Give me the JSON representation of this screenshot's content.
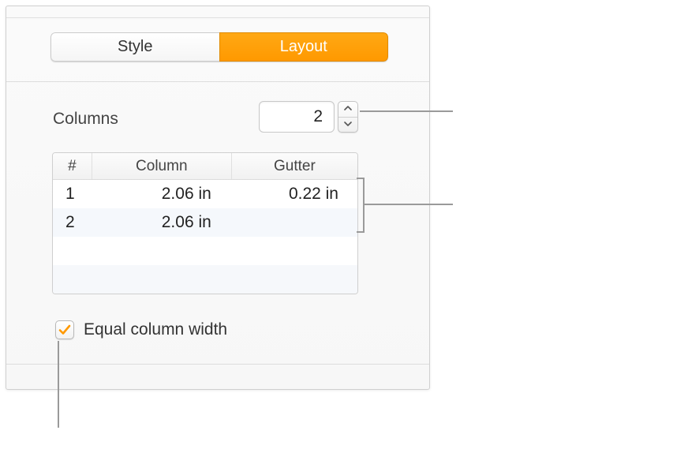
{
  "tabs": {
    "style": "Style",
    "layout": "Layout"
  },
  "columns": {
    "label": "Columns",
    "count": "2"
  },
  "table": {
    "headers": {
      "num": "#",
      "column": "Column",
      "gutter": "Gutter"
    },
    "rows": [
      {
        "num": "1",
        "column": "2.06 in",
        "gutter": "0.22 in"
      },
      {
        "num": "2",
        "column": "2.06 in",
        "gutter": ""
      }
    ]
  },
  "equalWidth": {
    "label": "Equal column width",
    "checked": true
  },
  "colors": {
    "accent": "#ff9900"
  }
}
